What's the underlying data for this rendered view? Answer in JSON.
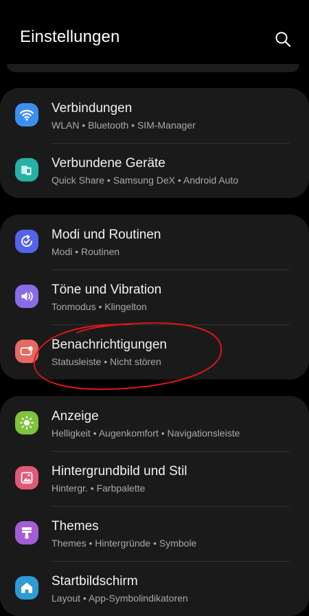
{
  "header": {
    "title": "Einstellungen"
  },
  "groups": [
    {
      "items": [
        {
          "title": "Verbindungen",
          "subtitle": "WLAN  •  Bluetooth  •  SIM-Manager",
          "icon": "wifi-icon",
          "color": "#3b8ff2"
        },
        {
          "title": "Verbundene Geräte",
          "subtitle": "Quick Share  •  Samsung DeX  •  Android Auto",
          "icon": "devices-icon",
          "color": "#25b2a6"
        }
      ]
    },
    {
      "items": [
        {
          "title": "Modi und Routinen",
          "subtitle": "Modi  •  Routinen",
          "icon": "routine-check-icon",
          "color": "#5463e8"
        },
        {
          "title": "Töne und Vibration",
          "subtitle": "Tonmodus  •  Klingelton",
          "icon": "speaker-icon",
          "color": "#8a6be6"
        },
        {
          "title": "Benachrichtigungen",
          "subtitle": "Statusleiste  •  Nicht stören",
          "icon": "notification-icon",
          "color": "#e56a63"
        }
      ]
    },
    {
      "items": [
        {
          "title": "Anzeige",
          "subtitle": "Helligkeit  •  Augenkomfort  •  Navigationsleiste",
          "icon": "brightness-icon",
          "color": "#7fc23d"
        },
        {
          "title": "Hintergrundbild und Stil",
          "subtitle": "Hintergr.  •  Farbpalette",
          "icon": "wallpaper-icon",
          "color": "#e05a78"
        },
        {
          "title": "Themes",
          "subtitle": "Themes  •  Hintergründe  •  Symbole",
          "icon": "themes-brush-icon",
          "color": "#a35ed6"
        },
        {
          "title": "Startbildschirm",
          "subtitle": "Layout  •  App-Symbolindikatoren",
          "icon": "home-icon",
          "color": "#2e9bd6"
        }
      ]
    }
  ],
  "annotation": {
    "color": "#e0141c"
  }
}
